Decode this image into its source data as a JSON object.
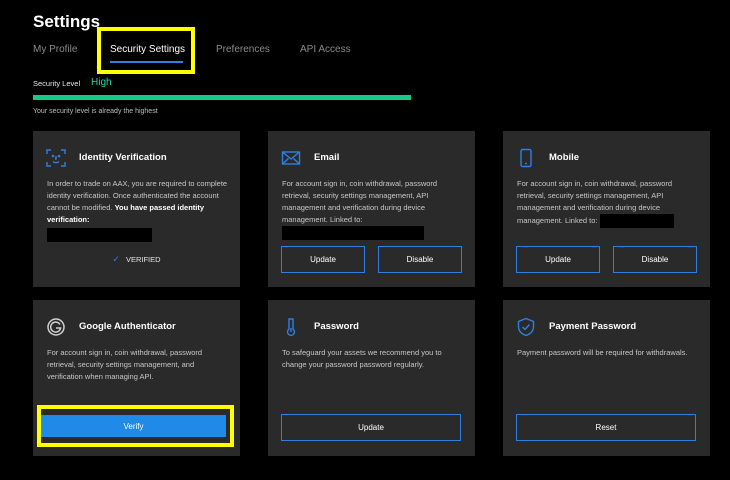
{
  "page": {
    "title": "Settings"
  },
  "tabs": [
    {
      "label": "My Profile",
      "active": false
    },
    {
      "label": "Security Settings",
      "active": true
    },
    {
      "label": "Preferences",
      "active": false
    },
    {
      "label": "API Access",
      "active": false
    }
  ],
  "security": {
    "label": "Security Level",
    "value": "High",
    "level_fraction": 1.0,
    "note": "Your security level is already the highest"
  },
  "cards": {
    "identity": {
      "icon": "face-scan-icon",
      "title": "Identity Verification",
      "desc": "In order to trade on AAX, you are required to complete identity verification. Once authenticated the account cannot be modified.",
      "desc_bold": "You have passed identity verification:",
      "status": "VERIFIED"
    },
    "email": {
      "icon": "envelope-icon",
      "title": "Email",
      "desc": "For account sign in, coin withdrawal, password retrieval, security settings management, API management and verification during device management. Linked to:",
      "update_label": "Update",
      "disable_label": "Disable"
    },
    "mobile": {
      "icon": "mobile-phone-icon",
      "title": "Mobile",
      "desc": "For account sign in, coin withdrawal, password retrieval, security settings management, API management and verification during device management. Linked to:",
      "update_label": "Update",
      "disable_label": "Disable"
    },
    "google": {
      "icon": "google-g-icon",
      "title": "Google Authenticator",
      "desc": "For account sign in, coin withdrawal, password retrieval, security settings management, and verification when managing API.",
      "verify_label": "Verify"
    },
    "password": {
      "icon": "thermometer-key-icon",
      "title": "Password",
      "desc": "To safeguard your assets we recommend you to change your password password regularly.",
      "update_label": "Update"
    },
    "payment": {
      "icon": "shield-check-icon",
      "title": "Payment Password",
      "desc": "Payment password will be required for withdrawals.",
      "reset_label": "Reset"
    }
  },
  "colors": {
    "background": "#000000",
    "card": "#2a2a2a",
    "accent_blue": "#2f7fe0",
    "security_green": "#16c989",
    "highlight_yellow": "#ffff00"
  }
}
